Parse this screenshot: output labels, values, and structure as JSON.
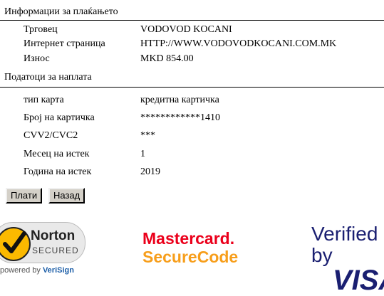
{
  "payment_info": {
    "title": "Информации за плаќањето",
    "rows": [
      {
        "label": "Трговец",
        "value": "VODOVOD KOCANI"
      },
      {
        "label": "Интернет страница",
        "value": "HTTP://WWW.VODOVODKOCANI.COM.MK"
      },
      {
        "label": "Износ",
        "value": "MKD  854.00"
      }
    ]
  },
  "payment_details": {
    "title": "Податоци за наплата",
    "rows": [
      {
        "label": "тип карта",
        "value": "кредитна картичка"
      },
      {
        "label": "Број на картичка",
        "value": "************1410"
      },
      {
        "label": "CVV2/CVC2",
        "value": "***"
      },
      {
        "label": "Месец на истек",
        "value": "1"
      },
      {
        "label": "Година на истек",
        "value": "2019"
      }
    ]
  },
  "buttons": {
    "pay": "Плати",
    "back": "Назад"
  },
  "logos": {
    "norton": {
      "word": "Norton",
      "secured": "SECURED",
      "by_prefix": "powered by",
      "by_brand": "VeriSign"
    },
    "mastercard": {
      "line1": "Mastercard.",
      "line2": "SecureCode"
    },
    "visa": {
      "line1": "Verified by",
      "line2": "VISA"
    }
  }
}
